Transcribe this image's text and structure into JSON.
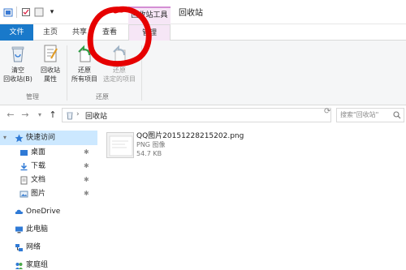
{
  "titlebar": {
    "context_tab": "回收站工具",
    "window_title": "回收站",
    "qa_dropdown": "▾"
  },
  "tabs": {
    "file": "文件",
    "home": "主页",
    "share": "共享",
    "view": "查看",
    "manage": "管理"
  },
  "ribbon": {
    "empty_bin": "清空\n回收站(B)",
    "bin_properties": "回收站\n属性",
    "restore_all": "还原\n所有项目",
    "restore_selected": "还原\n选定的项目",
    "group_manage": "管理",
    "group_restore": "还原"
  },
  "address": {
    "back": "←",
    "forward": "→",
    "recent": "▾",
    "up": "↑",
    "crumb_sep": "›",
    "path": "回收站",
    "search_placeholder": "搜索\"回收站\""
  },
  "nav": {
    "quick_access": "快速访问",
    "desktop": "桌面",
    "downloads": "下载",
    "documents": "文档",
    "pictures": "图片",
    "onedrive": "OneDrive",
    "this_pc": "此电脑",
    "network": "网络",
    "homegroup": "家庭组",
    "pin": "✱"
  },
  "file": {
    "name": "QQ图片20151228215202.png",
    "type": "PNG 图像",
    "size": "54.7 KB"
  },
  "colors": {
    "file_tab": "#1979ca",
    "context_tab": "#f6e6f6",
    "annotation": "#e60000",
    "selection": "#cce8ff"
  }
}
